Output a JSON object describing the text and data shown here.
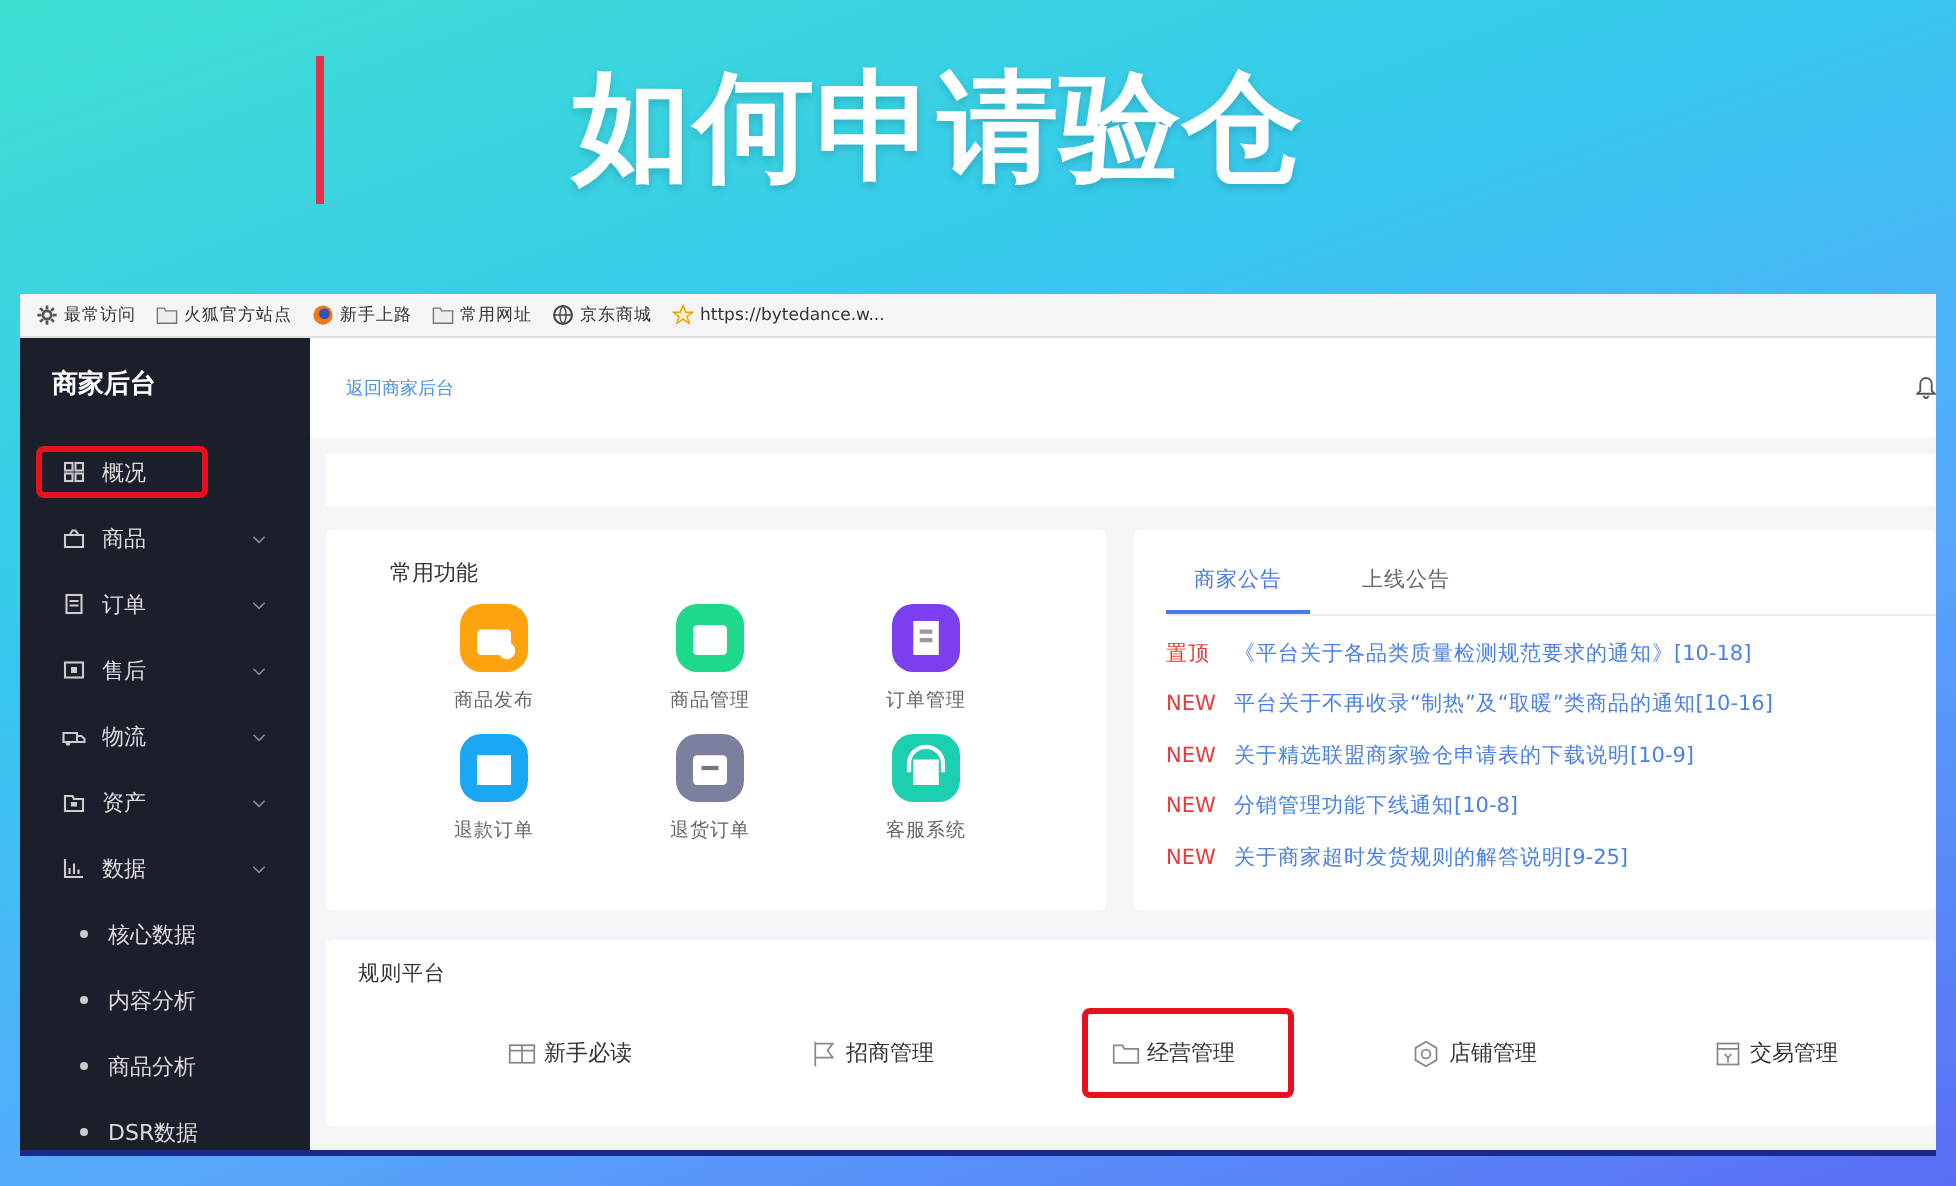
{
  "slide_title": "如何申请验仓",
  "bookmarks": [
    "最常访问",
    "火狐官方站点",
    "新手上路",
    "常用网址",
    "京东商城",
    "https://bytedance.w..."
  ],
  "sidebar": {
    "title": "商家后台",
    "items": [
      {
        "label": "概况",
        "kind": "link",
        "highlighted": true
      },
      {
        "label": "商品",
        "kind": "group",
        "highlighted": false
      },
      {
        "label": "订单",
        "kind": "group",
        "highlighted": false
      },
      {
        "label": "售后",
        "kind": "group",
        "highlighted": false
      },
      {
        "label": "物流",
        "kind": "group",
        "highlighted": false
      },
      {
        "label": "资产",
        "kind": "group",
        "highlighted": false
      },
      {
        "label": "数据",
        "kind": "group",
        "highlighted": false,
        "children": [
          {
            "label": "核心数据"
          },
          {
            "label": "内容分析"
          },
          {
            "label": "商品分析"
          },
          {
            "label": "DSR数据"
          }
        ]
      }
    ]
  },
  "topbar": {
    "back_link": "返回商家后台"
  },
  "common_functions": {
    "title": "常用功能",
    "items": [
      {
        "label": "商品发布",
        "color": "#ffa20f"
      },
      {
        "label": "商品管理",
        "color": "#1ed98a"
      },
      {
        "label": "订单管理",
        "color": "#7b3ff0"
      },
      {
        "label": "退款订单",
        "color": "#1aa8f5"
      },
      {
        "label": "退货订单",
        "color": "#7c7f9e"
      },
      {
        "label": "客服系统",
        "color": "#1ccfb0"
      }
    ]
  },
  "announcements": {
    "tabs": [
      {
        "label": "商家公告",
        "selected": true
      },
      {
        "label": "上线公告",
        "selected": false
      }
    ],
    "items": [
      {
        "tag": "置顶",
        "text": "《平台关于各品类质量检测规范要求的通知》[10-18]"
      },
      {
        "tag": "NEW",
        "text": "平台关于不再收录“制热”及“取暖”类商品的通知[10-16]"
      },
      {
        "tag": "NEW",
        "text": "关于精选联盟商家验仓申请表的下载说明[10-9]"
      },
      {
        "tag": "NEW",
        "text": "分销管理功能下线通知[10-8]"
      },
      {
        "tag": "NEW",
        "text": "关于商家超时发货规则的解答说明[9-25]"
      }
    ]
  },
  "rules_platform": {
    "title": "规则平台",
    "items": [
      {
        "label": "新手必读",
        "highlighted": false
      },
      {
        "label": "招商管理",
        "highlighted": false
      },
      {
        "label": "经营管理",
        "highlighted": true
      },
      {
        "label": "店铺管理",
        "highlighted": false
      },
      {
        "label": "交易管理",
        "highlighted": false
      }
    ]
  }
}
